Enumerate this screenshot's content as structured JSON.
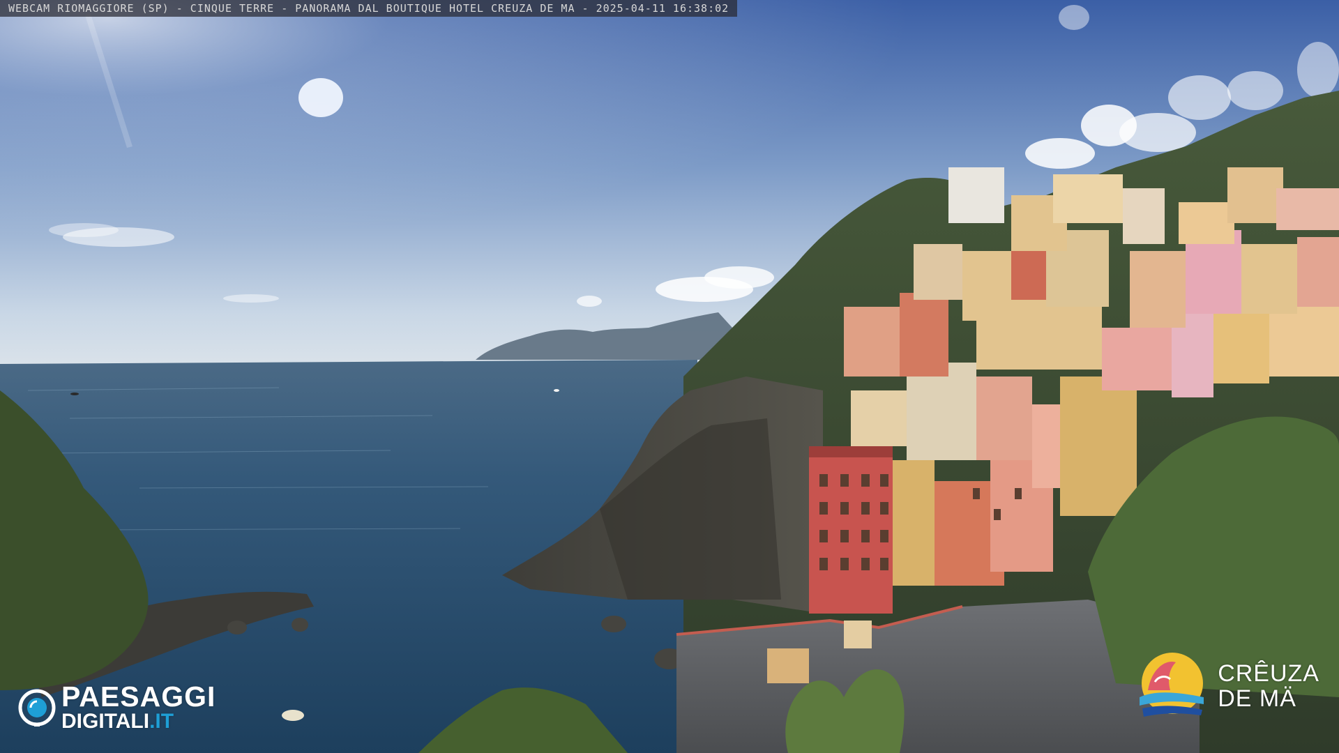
{
  "overlay": {
    "caption": "WEBCAM RIOMAGGIORE (SP) - CINQUE TERRE - PANORAMA DAL BOUTIQUE HOTEL CREUZA DE MA - 2025-04-11 16:38:02"
  },
  "logos": {
    "left": {
      "line1": "PAESAGGI",
      "line2_main": "DIGITALI",
      "line2_suffix": ".IT",
      "accent_color": "#1e9fd6",
      "icon": "eye-camera-icon"
    },
    "right": {
      "line1": "CRÊUZA",
      "line2": "DE MÄ",
      "icon": "creuza-de-ma-emblem-icon",
      "colors": [
        "#f2c230",
        "#e05a6a",
        "#3aa6d8",
        "#1f4fa0"
      ]
    }
  },
  "palette": {
    "sky_top": "#3c63a8",
    "sky_horizon": "#c8d6e4",
    "sea_deep": "#1c3d5c",
    "sea_near": "#2b5a78",
    "hill": "#3e4e34",
    "cliff": "#4a4a42",
    "vegetation": "#3f5a2e",
    "roof": "#5b5d60"
  }
}
